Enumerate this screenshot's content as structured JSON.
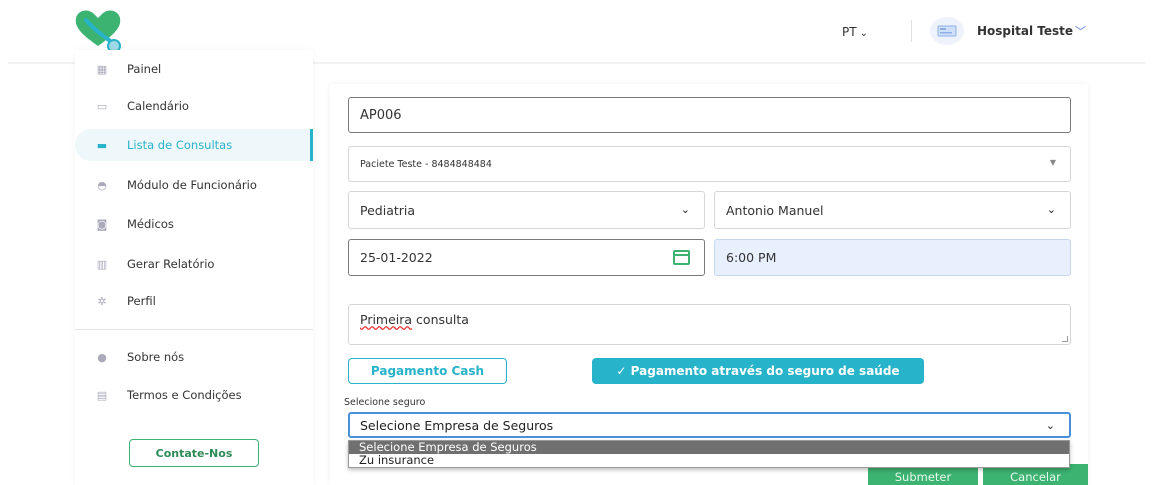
{
  "header": {
    "language": "PT",
    "hospital_name": "Hospital Teste"
  },
  "sidebar": {
    "items": [
      {
        "label": "Painel",
        "icon": "dashboard-icon"
      },
      {
        "label": "Calendário",
        "icon": "calendar-icon"
      },
      {
        "label": "Lista de Consultas",
        "icon": "list-icon",
        "active": true
      },
      {
        "label": "Módulo de Funcionário",
        "icon": "users-icon"
      },
      {
        "label": "Médicos",
        "icon": "camera-icon"
      },
      {
        "label": "Gerar Relatório",
        "icon": "chart-icon"
      },
      {
        "label": "Perfil",
        "icon": "gear-icon"
      }
    ],
    "bottom_items": [
      {
        "label": "Sobre nós",
        "icon": "info-icon"
      },
      {
        "label": "Termos e Condições",
        "icon": "document-icon"
      }
    ],
    "contact_label": "Contate-Nos"
  },
  "form": {
    "code": "AP006",
    "patient": "Paciete Teste - 8484848484",
    "specialty": "Pediatria",
    "doctor": "Antonio Manuel",
    "date": "25-01-2022",
    "time": "6:00 PM",
    "notes_word1": "Primeira",
    "notes_rest": " consulta",
    "pay_cash_label": "Pagamento Cash",
    "pay_insurance_label": "Pagamento através do seguro de saúde",
    "insurance_label": "Selecione seguro",
    "insurance_selected": "Selecione Empresa de Seguros",
    "insurance_options": [
      "Selecione Empresa de Seguros",
      "Zu insurance"
    ],
    "submit_label": "Submeter",
    "cancel_label": "Cancelar"
  },
  "colors": {
    "accent": "#27b3c9",
    "green": "#3cb371"
  }
}
